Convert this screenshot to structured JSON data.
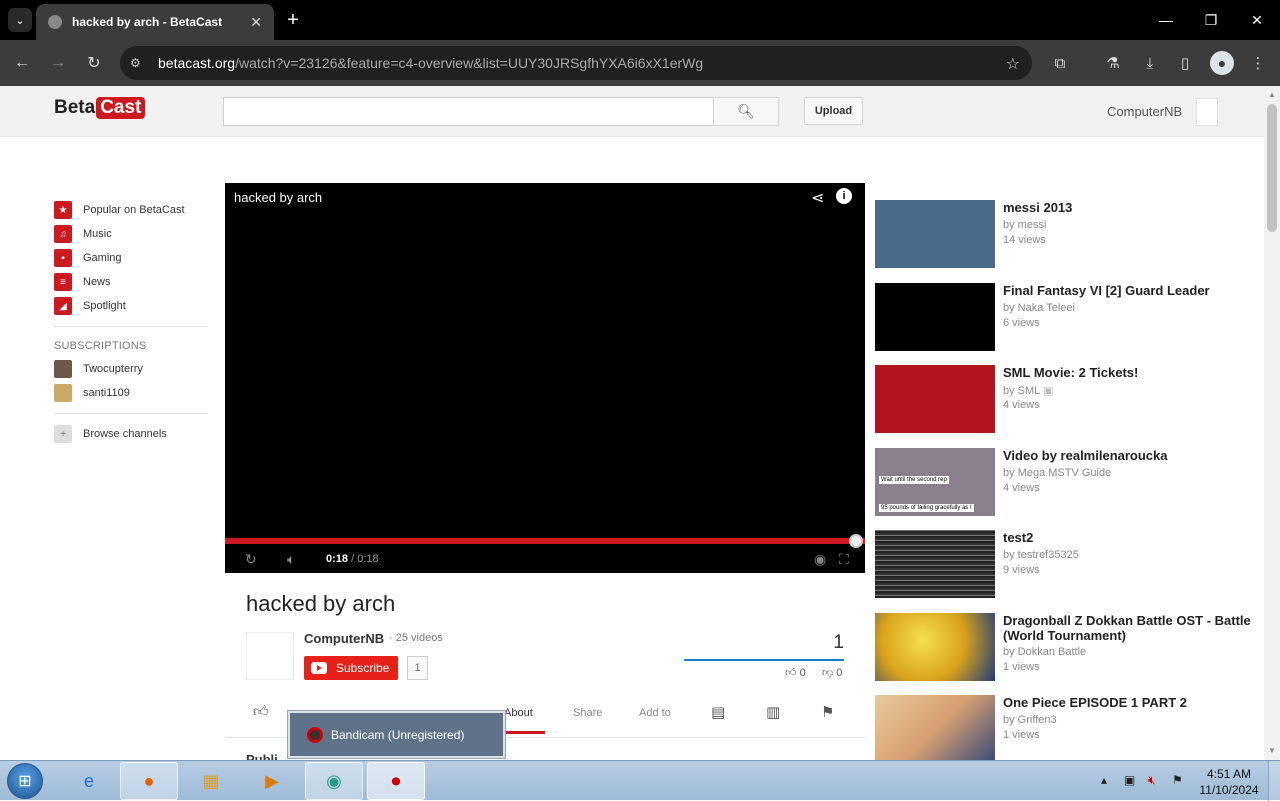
{
  "browser": {
    "tab_title": "hacked by arch - BetaCast",
    "url_host": "betacast.org",
    "url_path": "/watch?v=23126&feature=c4-overview&list=UUY30JRSgfhYXA6i6xX1erWg"
  },
  "site": {
    "logo_part1": "Beta",
    "logo_part2": "Cast",
    "upload_label": "Upload",
    "user_name": "ComputerNB"
  },
  "guide": {
    "items": [
      {
        "label": "Popular on BetaCast",
        "icon": "star-icon",
        "color": "#cc181e"
      },
      {
        "label": "Music",
        "icon": "headphones-icon",
        "color": "#cc181e"
      },
      {
        "label": "Gaming",
        "icon": "gamepad-icon",
        "color": "#cc181e"
      },
      {
        "label": "News",
        "icon": "newspaper-icon",
        "color": "#cc181e"
      },
      {
        "label": "Spotlight",
        "icon": "spotlight-icon",
        "color": "#cc181e"
      }
    ],
    "subscriptions_heading": "SUBSCRIPTIONS",
    "subscriptions": [
      {
        "label": "Twocupterry"
      },
      {
        "label": "santi1109"
      }
    ],
    "browse_label": "Browse channels"
  },
  "player": {
    "title": "hacked by arch",
    "current_time": "0:18",
    "duration": "/ 0:18",
    "progress": 1.0
  },
  "watch": {
    "title": "hacked by arch",
    "owner": "ComputerNB",
    "video_count": "· 25 videos",
    "subscribe_label": "Subscribe",
    "subscriber_count": "1",
    "view_count": "1",
    "likes": "0",
    "dislikes": "0",
    "tabs": {
      "about": "About",
      "share": "Share",
      "add_to": "Add to"
    },
    "details_partial": "Publi"
  },
  "recommendations": [
    {
      "title": "messi 2013",
      "by": "by messi",
      "views": "14 views",
      "thumb": "#4a6a8a"
    },
    {
      "title": "Final Fantasy VI [2] Guard Leader",
      "by": "by Naka Teleei",
      "views": "6 views",
      "thumb": "#000000"
    },
    {
      "title": "SML Movie: 2 Tickets!",
      "by": "by SML",
      "views": "4 views",
      "thumb": "#b0141c"
    },
    {
      "title": "Video by realmilenaroucka",
      "by": "by Mega MSTV Guide",
      "views": "4 views",
      "thumb": "#8a7f8c",
      "caption1": "Wait until the second rep",
      "caption2": "95 pounds of failing gracefully as I"
    },
    {
      "title": "test2",
      "by": "by testref35325",
      "views": "9 views",
      "thumb": "#555555"
    },
    {
      "title": "Dragonball Z Dokkan Battle OST - Battle (World Tournament)",
      "by": "by Dokkan Battle",
      "views": "1 views",
      "thumb": "#d9a21c"
    },
    {
      "title": "One Piece EPISODE 1 PART 2",
      "by": "by Griffen3",
      "views": "1 views",
      "thumb": "#d8a070"
    }
  ],
  "popup": {
    "label": "Bandicam (Unregistered)"
  },
  "taskbar": {
    "time": "4:51 AM",
    "date": "11/10/2024"
  }
}
